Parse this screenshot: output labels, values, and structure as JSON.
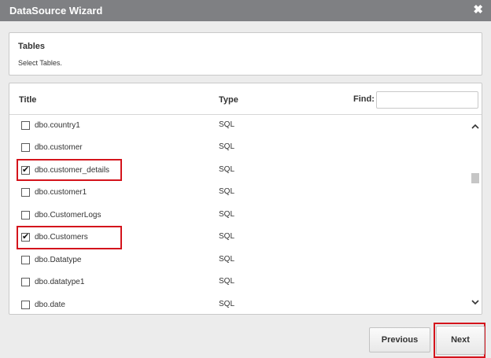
{
  "window": {
    "title": "DataSource Wizard",
    "close_glyph": "✖"
  },
  "header": {
    "heading": "Tables",
    "subtitle": "Select Tables."
  },
  "table": {
    "columns": {
      "title": "Title",
      "type": "Type"
    },
    "find": {
      "label": "Find:",
      "value": "",
      "placeholder": ""
    },
    "rows": [
      {
        "name": "dbo.country1",
        "type": "SQL",
        "checked": false
      },
      {
        "name": "dbo.customer",
        "type": "SQL",
        "checked": false
      },
      {
        "name": "dbo.customer_details",
        "type": "SQL",
        "checked": true
      },
      {
        "name": "dbo.customer1",
        "type": "SQL",
        "checked": false
      },
      {
        "name": "dbo.CustomerLogs",
        "type": "SQL",
        "checked": false
      },
      {
        "name": "dbo.Customers",
        "type": "SQL",
        "checked": true
      },
      {
        "name": "dbo.Datatype",
        "type": "SQL",
        "checked": false
      },
      {
        "name": "dbo.datatype1",
        "type": "SQL",
        "checked": false
      },
      {
        "name": "dbo.date",
        "type": "SQL",
        "checked": false
      }
    ]
  },
  "footer": {
    "previous_label": "Previous",
    "next_label": "Next"
  },
  "colors": {
    "titlebar": "#7f8083",
    "highlight": "#d4141c"
  },
  "icons": {
    "close": "close-icon",
    "scroll_up": "chevron-up-icon",
    "scroll_down": "chevron-down-icon"
  }
}
